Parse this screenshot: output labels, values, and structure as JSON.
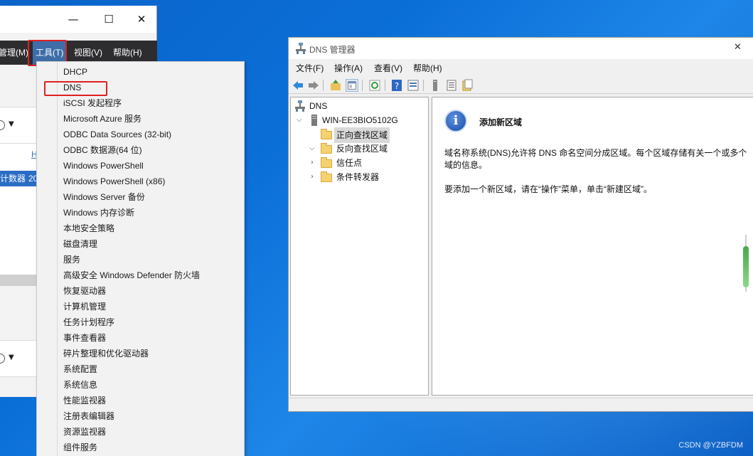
{
  "server_manager": {
    "menu": {
      "manage_label": "管理(M)",
      "tools_label": "工具(T)",
      "view_label": "视图(V)",
      "help_label": "帮助(H)"
    },
    "window_controls": {
      "minimize": "—",
      "maximize": "☐",
      "close": "✕"
    },
    "left_strip": {
      "header_link": "H",
      "row_text": "计数器",
      "row_number": "20"
    }
  },
  "tools_menu": {
    "items": [
      "DHCP",
      "DNS",
      "iSCSI 发起程序",
      "Microsoft Azure 服务",
      "ODBC Data Sources (32-bit)",
      "ODBC 数据源(64 位)",
      "Windows PowerShell",
      "Windows PowerShell (x86)",
      "Windows Server 备份",
      "Windows 内存诊断",
      "本地安全策略",
      "磁盘清理",
      "服务",
      "高级安全 Windows Defender 防火墙",
      "恢复驱动器",
      "计算机管理",
      "任务计划程序",
      "事件查看器",
      "碎片整理和优化驱动器",
      "系统配置",
      "系统信息",
      "性能监视器",
      "注册表编辑器",
      "资源监视器",
      "组件服务"
    ],
    "highlighted_item": "DNS"
  },
  "dns_manager": {
    "title": "DNS 管理器",
    "window_close": "✕",
    "menu": {
      "file": "文件(F)",
      "action": "操作(A)",
      "view": "查看(V)",
      "help": "帮助(H)"
    },
    "toolbar_icons": [
      "back-icon",
      "forward-icon",
      "up-folder-icon",
      "show-hide-tree-icon",
      "refresh-icon",
      "help-icon",
      "properties-icon",
      "server-icon",
      "list-icon",
      "export-icon"
    ],
    "tree": {
      "root": "DNS",
      "server": "WIN-EE3BIO5102G",
      "items": [
        "正向查找区域",
        "反向查找区域",
        "信任点",
        "条件转发器"
      ],
      "selected": "正向查找区域"
    },
    "content": {
      "heading": "添加新区域",
      "paragraph1_line1": "域名称系统(DNS)允许将 DNS 命名空间分成区域。每个区域存储有关一个或多个",
      "paragraph1_line2": "域的信息。",
      "paragraph2": "要添加一个新区域，请在“操作”菜单，单击“新建区域”。"
    }
  },
  "watermark": "CSDN @YZBFDM",
  "colors": {
    "desktop_blue": "#0b6fd8",
    "menubar_dark": "#2d2d30",
    "highlight_red": "#e02020",
    "selected_gray": "#d9d9d9"
  }
}
